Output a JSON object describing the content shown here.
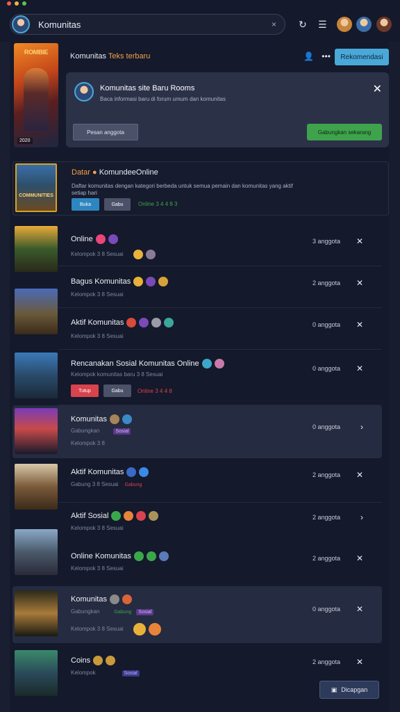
{
  "window": {
    "dots": [
      "#ed5f57",
      "#f0b73a",
      "#5ec548"
    ]
  },
  "search": {
    "value": "Komunitas",
    "clear_icon": "×"
  },
  "toolbar": {
    "refresh_icon": "↻",
    "menu_icon": "☰",
    "avatars": [
      "#c8853a",
      "#3a6ea8",
      "#6b3a2a"
    ]
  },
  "hero": {
    "image_title": "ROMBIE",
    "image_badge": "2020",
    "label_prefix": "Komunitas",
    "label_highlight": "Teks terbaru",
    "more_icon": "•••",
    "primary_button": "Rekomendasi"
  },
  "notice": {
    "title": "Komunitas site Baru Rooms",
    "subtitle": "Baca informasi baru di forum umum dan komunitas",
    "close_icon": "✕",
    "secondary_button": "Pesan anggota",
    "primary_button": "Gabungkan sekarang"
  },
  "featured": {
    "image_title": "COMMUNITIES",
    "name": "Datar",
    "name2": "KomundeeOnline",
    "desc": "Daftar komunitas dengan kategori berbeda untuk semua pemain dan komunitas yang aktif setiap hari",
    "button1": "Buka",
    "button2": "Gabu",
    "status": "Online 3 4 4 8 3"
  },
  "rows": [
    {
      "name": "Online",
      "sub": "Kelompok 3 8 Sesuai",
      "count": "3 anggota",
      "action": "✕"
    },
    {
      "name": "Bagus Komunitas",
      "sub": "Kelompok 3 8 Sesuai",
      "count": "2 anggota",
      "action": "✕"
    },
    {
      "name": "Aktif Komunitas",
      "sub": "Kelompok 3 8 Sesuai",
      "count": "0 anggota",
      "action": "✕"
    },
    {
      "name": "Rencanakan Sosial Komunitas Online",
      "sub": "Kelompok komunitas baru 3 8 Sesuai",
      "count": "0 anggota",
      "action": "✕",
      "button1": "Tutup",
      "button2": "Gabu",
      "status": "Online 3 4 4 8"
    },
    {
      "name": "Komunitas",
      "sub": "Gabungkan",
      "count": "0 anggota",
      "action": "›",
      "tag": "Sosial",
      "sub2": "Kelompok 3 8"
    },
    {
      "name": "Aktif Komunitas",
      "sub": "Gabung 3 8 Sesuai",
      "count": "2 anggota",
      "action": "✕",
      "tag": "Gabung"
    },
    {
      "name": "Aktif Sosial",
      "sub": "Kelompok 3 8 Sesuai",
      "count": "2 anggota",
      "action": "›"
    },
    {
      "name": "Online Komunitas",
      "sub": "Kelompok 3 8 Sesuai",
      "count": "2 anggota",
      "action": "✕"
    },
    {
      "name": "Komunitas",
      "sub": "Gabungkan",
      "count": "0 anggota",
      "action": "✕",
      "tag": "Sosial",
      "tag2": "Gabung",
      "sub2": "Kelompok 3 8 Sesuai"
    },
    {
      "name": "Coins",
      "sub": "Kelompok",
      "count": "2 anggota",
      "action": "✕",
      "tag": "Sosial"
    }
  ],
  "floating_button": "Dicapgan"
}
